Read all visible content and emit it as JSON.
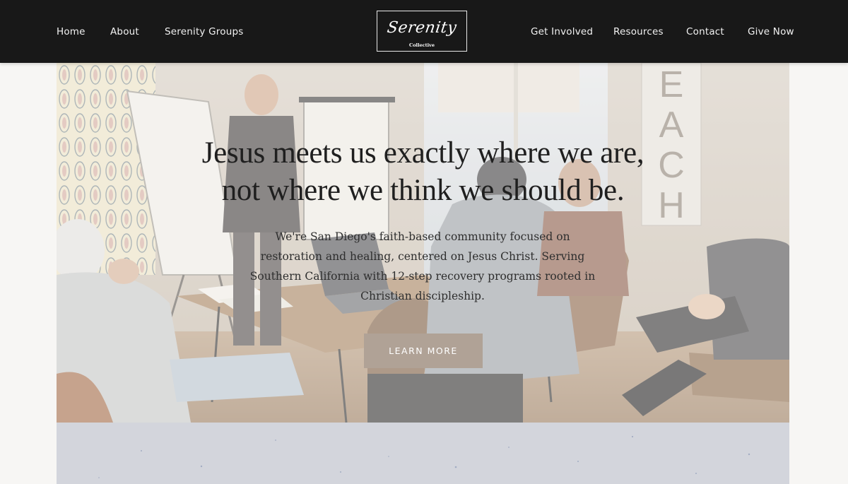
{
  "nav": {
    "left": [
      {
        "label": "Home"
      },
      {
        "label": "About"
      },
      {
        "label": "Serenity Groups"
      }
    ],
    "right": [
      {
        "label": "Get Involved"
      },
      {
        "label": "Resources"
      },
      {
        "label": "Contact"
      },
      {
        "label": "Give Now"
      }
    ]
  },
  "logo": {
    "script_text": "Serenity",
    "sub_text": "Collective"
  },
  "hero": {
    "headline_line1": "Jesus meets us exactly where we are,",
    "headline_line2": "not where we think we should be.",
    "intro": "We're San Diego's faith-based community focused on restoration and healing, centered on Jesus Christ. Serving Southern California with 12-step recovery programs rooted in Christian discipleship.",
    "cta_label": "LEARN MORE",
    "wall_letters": [
      "E",
      "A",
      "C",
      "H"
    ]
  },
  "colors": {
    "header_bg": "#181818",
    "header_text": "#f2f2f2",
    "cta_bg": "#b0a296",
    "page_bg": "#f7f6f4",
    "lower_section_bg": "#d3d5dc"
  }
}
